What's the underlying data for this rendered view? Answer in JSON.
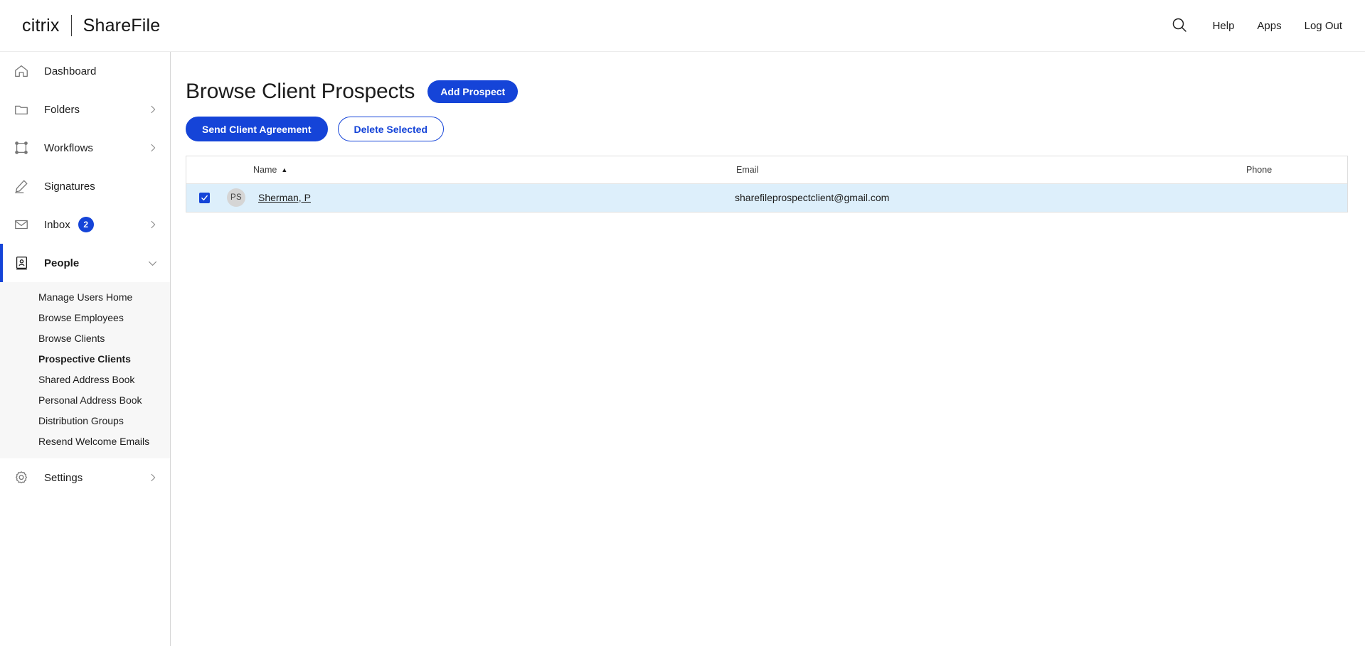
{
  "header": {
    "brand_citrix": "citrix",
    "brand_product": "ShareFile",
    "search_icon": "search-icon",
    "links": [
      {
        "label": "Help"
      },
      {
        "label": "Apps"
      },
      {
        "label": "Log Out"
      }
    ]
  },
  "sidebar": {
    "items": [
      {
        "label": "Dashboard",
        "icon": "home-icon",
        "chevron": "",
        "badge": ""
      },
      {
        "label": "Folders",
        "icon": "folder-icon",
        "chevron": "›",
        "badge": ""
      },
      {
        "label": "Workflows",
        "icon": "workflows-icon",
        "chevron": "›",
        "badge": ""
      },
      {
        "label": "Signatures",
        "icon": "pen-icon",
        "chevron": "",
        "badge": ""
      },
      {
        "label": "Inbox",
        "icon": "envelope-icon",
        "chevron": "›",
        "badge": "2"
      },
      {
        "label": "People",
        "icon": "contact-book-icon",
        "chevron": "∨",
        "badge": ""
      }
    ],
    "submenu": [
      {
        "label": "Manage Users Home"
      },
      {
        "label": "Browse Employees"
      },
      {
        "label": "Browse Clients"
      },
      {
        "label": "Prospective Clients"
      },
      {
        "label": "Shared Address Book"
      },
      {
        "label": "Personal Address Book"
      },
      {
        "label": "Distribution Groups"
      },
      {
        "label": "Resend Welcome Emails"
      }
    ],
    "settings": {
      "label": "Settings",
      "icon": "gear-icon",
      "chevron": "›"
    }
  },
  "main": {
    "page_title": "Browse Client Prospects",
    "add_prospect_label": "Add Prospect",
    "send_agreement_label": "Send Client Agreement",
    "delete_selected_label": "Delete Selected",
    "table": {
      "columns": {
        "name": "Name",
        "sort_indicator": "▲",
        "email": "Email",
        "phone": "Phone"
      },
      "rows": [
        {
          "checked": true,
          "initials": "PS",
          "name": "Sherman, P",
          "email": "sharefileprospectclient@gmail.com",
          "phone": ""
        }
      ]
    }
  },
  "colors": {
    "accent_blue": "#1544d8",
    "row_highlight": "#ddeffb",
    "submenu_bg": "#f7f7f7",
    "avatar_bg": "#d5d5d5"
  }
}
